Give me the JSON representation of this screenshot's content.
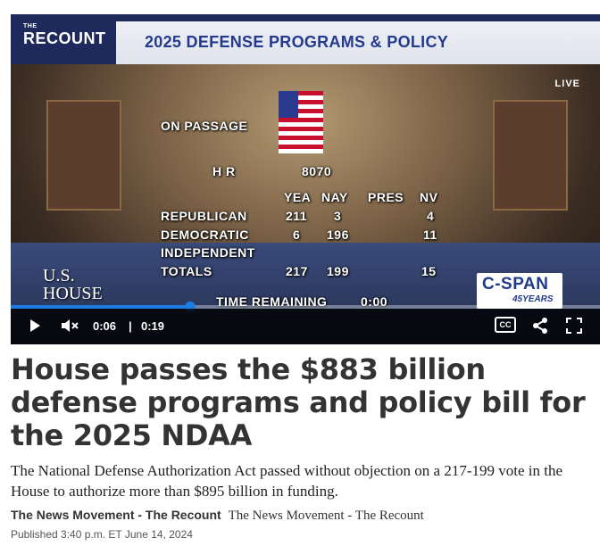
{
  "video": {
    "logo_small": "THE",
    "logo": "RECOUNT",
    "banner_title": "2025 DEFENSE PROGRAMS & POLICY",
    "live_label": "LIVE",
    "vote_board": {
      "on_passage": "ON PASSAGE",
      "bill": "H R",
      "bill_number": "8070",
      "columns": [
        "YEA",
        "NAY",
        "PRES",
        "NV"
      ],
      "rows": [
        {
          "label": "REPUBLICAN",
          "yea": "211",
          "nay": "3",
          "pres": "",
          "nv": "4"
        },
        {
          "label": "DEMOCRATIC",
          "yea": "6",
          "nay": "196",
          "pres": "",
          "nv": "11"
        },
        {
          "label": "INDEPENDENT",
          "yea": "",
          "nay": "",
          "pres": "",
          "nv": ""
        },
        {
          "label": "TOTALS",
          "yea": "217",
          "nay": "199",
          "pres": "",
          "nv": "15"
        }
      ],
      "time_remaining_label": "TIME REMAINING",
      "time_remaining": "0:00"
    },
    "house_logo_line1": "U.S.",
    "house_logo_line2": "HOUSE",
    "network_logo": "C-SPAN",
    "network_logo_sub": "45YEARS",
    "controls": {
      "current_time": "0:06",
      "separator": "|",
      "duration": "0:19",
      "progress_fraction": 0.305,
      "accent_color": "#1e7de0",
      "play_icon": "play-icon",
      "mute_icon": "muted-speaker-icon",
      "cc_label": "CC",
      "share_icon": "share-icon",
      "fullscreen_icon": "fullscreen-icon"
    }
  },
  "article": {
    "headline": "House passes the $883 billion defense programs and policy bill for the 2025 NDAA",
    "summary": "The National Defense Authorization Act passed without objection on a 217-199 vote in the House to authorize more than $895 billion in funding.",
    "byline_bold": "The News Movement - The Recount",
    "byline_secondary": "The News Movement - The Recount",
    "published": "Published 3:40 p.m. ET June 14, 2024"
  }
}
